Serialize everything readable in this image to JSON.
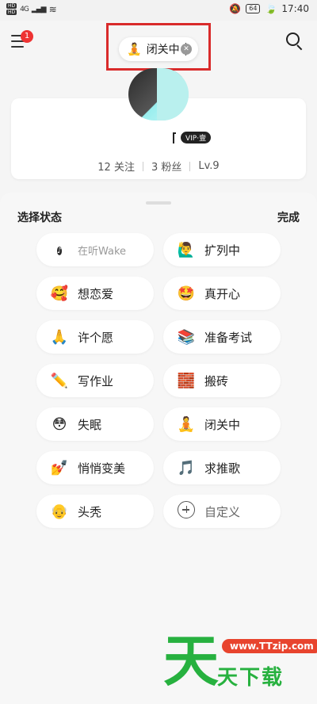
{
  "statusbar": {
    "sim1": "HD",
    "sim2": "HD",
    "network": "4G",
    "battery": "64",
    "time": "17:40"
  },
  "header": {
    "menu_badge": "1",
    "current_status": {
      "emoji": "🧘",
      "label": "闭关中"
    }
  },
  "profile": {
    "vip_label": "VIP·壹",
    "stats": {
      "following": "12 关注",
      "fans": "3 粉丝",
      "level": "Lv.9"
    }
  },
  "sheet": {
    "title": "选择状态",
    "done_label": "完成",
    "options": [
      {
        "emoji": "Wake",
        "label": "在听Wake"
      },
      {
        "emoji": "🙋‍♂️",
        "label": "扩列中"
      },
      {
        "emoji": "🥰",
        "label": "想恋爱"
      },
      {
        "emoji": "🤩",
        "label": "真开心"
      },
      {
        "emoji": "🙏",
        "label": "许个愿"
      },
      {
        "emoji": "📚",
        "label": "准备考试"
      },
      {
        "emoji": "✏️",
        "label": "写作业"
      },
      {
        "emoji": "🧱",
        "label": "搬砖"
      },
      {
        "emoji": "😳",
        "label": "失眠"
      },
      {
        "emoji": "🧘",
        "label": "闭关中"
      },
      {
        "emoji": "💅",
        "label": "悄悄变美"
      },
      {
        "emoji": "🎵",
        "label": "求推歌"
      },
      {
        "emoji": "👴",
        "label": "头秃"
      },
      {
        "emoji": "+",
        "label": "自定义"
      }
    ]
  },
  "watermark": {
    "big": "天",
    "url": "www.TTzip.com",
    "text": "天下载"
  }
}
